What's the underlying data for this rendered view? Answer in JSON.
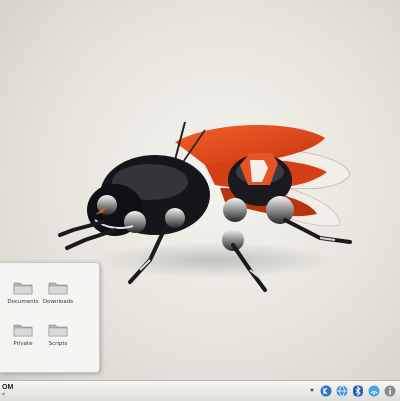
{
  "desktop": {
    "folder_view": {
      "items": [
        {
          "label": "Documents"
        },
        {
          "label": "Downloads"
        },
        {
          "label": "Private"
        },
        {
          "label": "Scripts"
        }
      ]
    }
  },
  "panel": {
    "logo_big": "OM",
    "logo_small": "al",
    "tray_icons": [
      "expand-arrow-icon",
      "kde-icon",
      "globe-icon",
      "bluetooth-icon",
      "network-icon",
      "info-icon"
    ]
  },
  "colors": {
    "wallpaper_bg": "#ecebe5",
    "bug_orange": "#e2471c",
    "bug_black": "#16161a",
    "tray_blue": "#2b74c8"
  }
}
